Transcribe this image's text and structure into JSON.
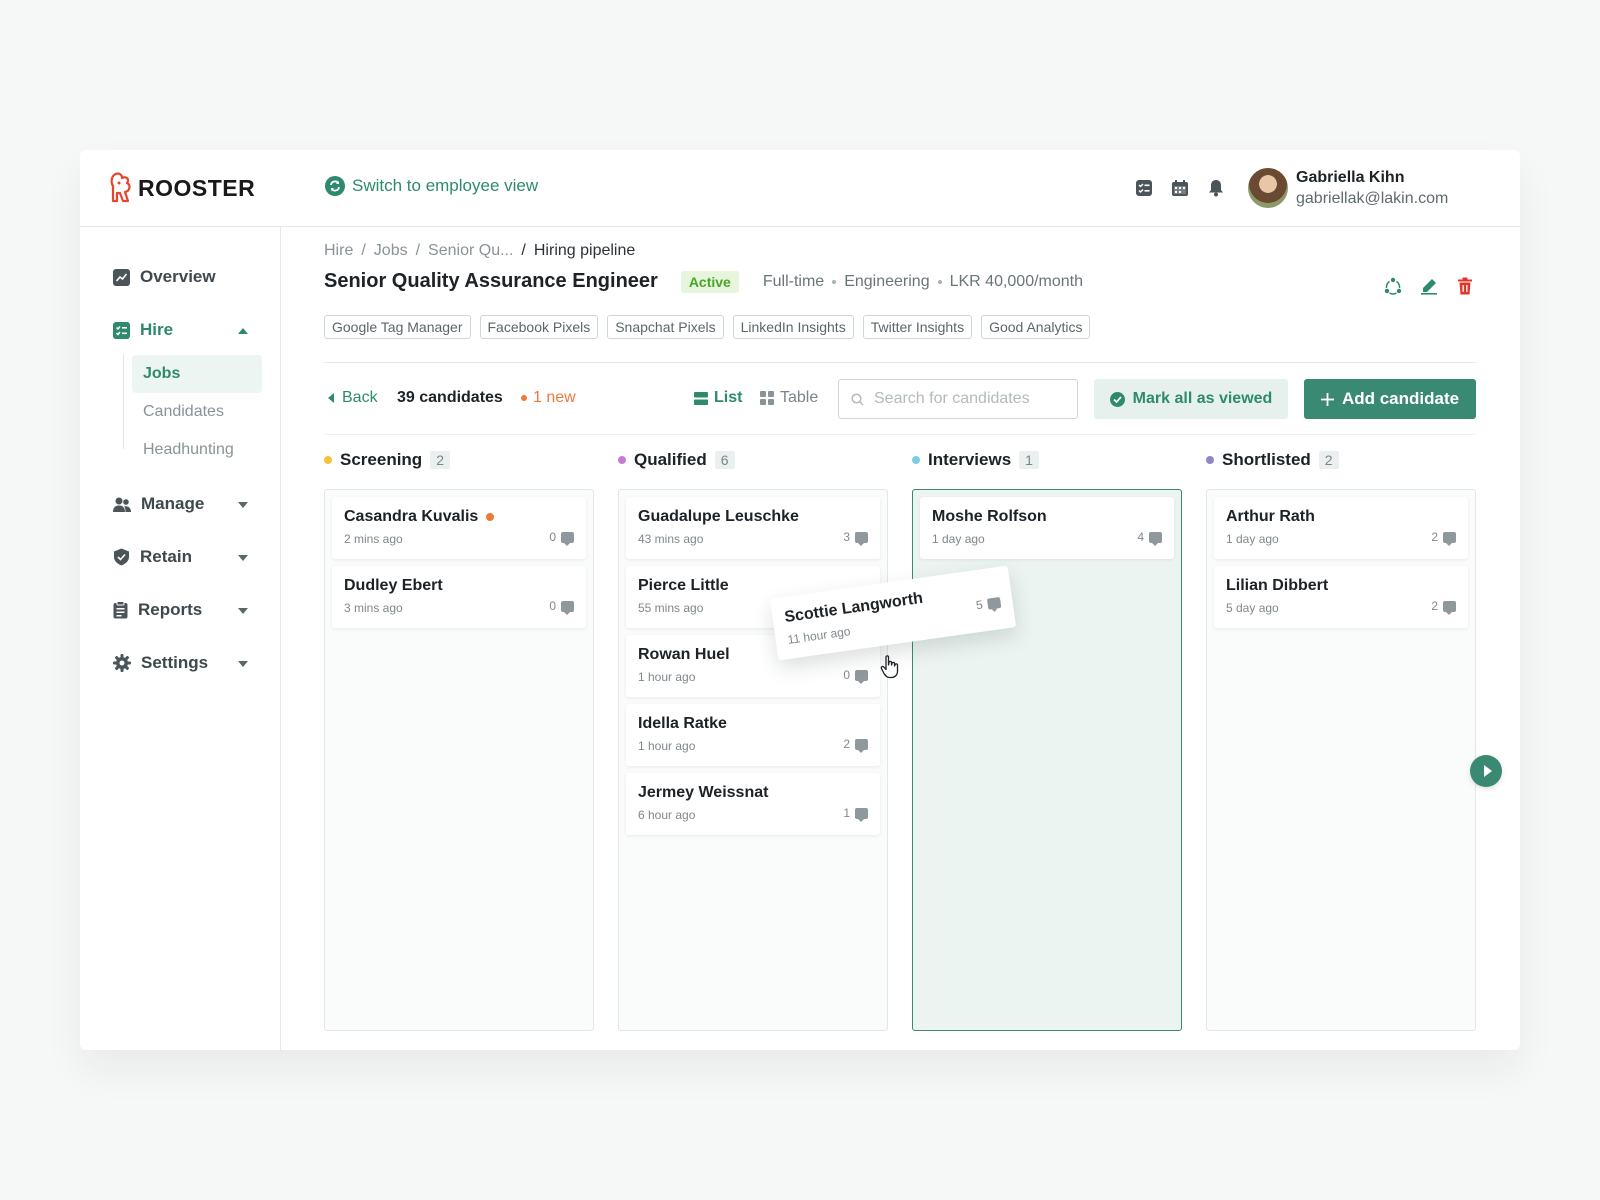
{
  "app": {
    "name": "ROOSTER",
    "switch_view": "Switch to employee view"
  },
  "topbar": {
    "icons": [
      "checklist-icon",
      "calendar-icon",
      "bell-icon"
    ]
  },
  "user": {
    "name": "Gabriella Kihn",
    "email": "gabriellak@lakin.com"
  },
  "sidebar": {
    "items": [
      {
        "label": "Overview",
        "icon": "chart-icon"
      },
      {
        "label": "Hire",
        "icon": "hire-icon"
      },
      {
        "label": "Manage",
        "icon": "users-icon"
      },
      {
        "label": "Retain",
        "icon": "shield-icon"
      },
      {
        "label": "Reports",
        "icon": "clipboard-icon"
      },
      {
        "label": "Settings",
        "icon": "gear-icon"
      }
    ],
    "hire_sub": [
      "Jobs",
      "Candidates",
      "Headhunting"
    ]
  },
  "breadcrumb": {
    "items": [
      "Hire",
      "/",
      "Jobs",
      "/",
      "Senior Qu...",
      "/",
      "Hiring pipeline"
    ]
  },
  "job": {
    "title": "Senior Quality Assurance Engineer",
    "status": "Active",
    "type": "Full-time",
    "department": "Engineering",
    "salary": "LKR 40,000/month",
    "tags": [
      "Google Tag Manager",
      "Facebook Pixels",
      "Snapchat Pixels",
      "LinkedIn Insights",
      "Twitter Insights",
      "Good Analytics"
    ]
  },
  "toolbar": {
    "back": "Back",
    "count": "39 candidates",
    "new": "1 new",
    "list": "List",
    "table": "Table",
    "search_placeholder": "Search for candidates",
    "mark_viewed": "Mark all as viewed",
    "add_candidate": "Add candidate"
  },
  "columns": [
    {
      "title": "Screening",
      "count": "2",
      "color": "#f2c33a",
      "cards": [
        {
          "name": "Casandra Kuvalis",
          "time": "2 mins ago",
          "comments": "0",
          "new": true
        },
        {
          "name": "Dudley Ebert",
          "time": "3 mins ago",
          "comments": "0"
        }
      ]
    },
    {
      "title": "Qualified",
      "count": "6",
      "color": "#c77ad6",
      "cards": [
        {
          "name": "Guadalupe Leuschke",
          "time": "43 mins ago",
          "comments": "3"
        },
        {
          "name": "Pierce Little",
          "time": "55 mins ago",
          "comments": "2",
          "unread": true
        },
        {
          "name": "Rowan Huel",
          "time": "1 hour ago",
          "comments": "0"
        },
        {
          "name": "Idella Ratke",
          "time": "1 hour ago",
          "comments": "2"
        },
        {
          "name": "Jermey Weissnat",
          "time": "6 hour ago",
          "comments": "1"
        }
      ]
    },
    {
      "title": "Interviews",
      "count": "1",
      "color": "#7ecbe6",
      "cards": [
        {
          "name": "Moshe Rolfson",
          "time": "1 day ago",
          "comments": "4"
        }
      ]
    },
    {
      "title": "Shortlisted",
      "count": "2",
      "color": "#8f86c4",
      "cards": [
        {
          "name": "Arthur Rath",
          "time": "1 day ago",
          "comments": "2"
        },
        {
          "name": "Lilian Dibbert",
          "time": "5 day ago",
          "comments": "2"
        }
      ]
    }
  ],
  "dragging_card": {
    "name": "Scottie Langworth",
    "time": "11 hour ago",
    "comments": "5"
  },
  "colors": {
    "accent": "#3a8a73",
    "new": "#ee7a3a",
    "active_badge": "#49a52a"
  }
}
